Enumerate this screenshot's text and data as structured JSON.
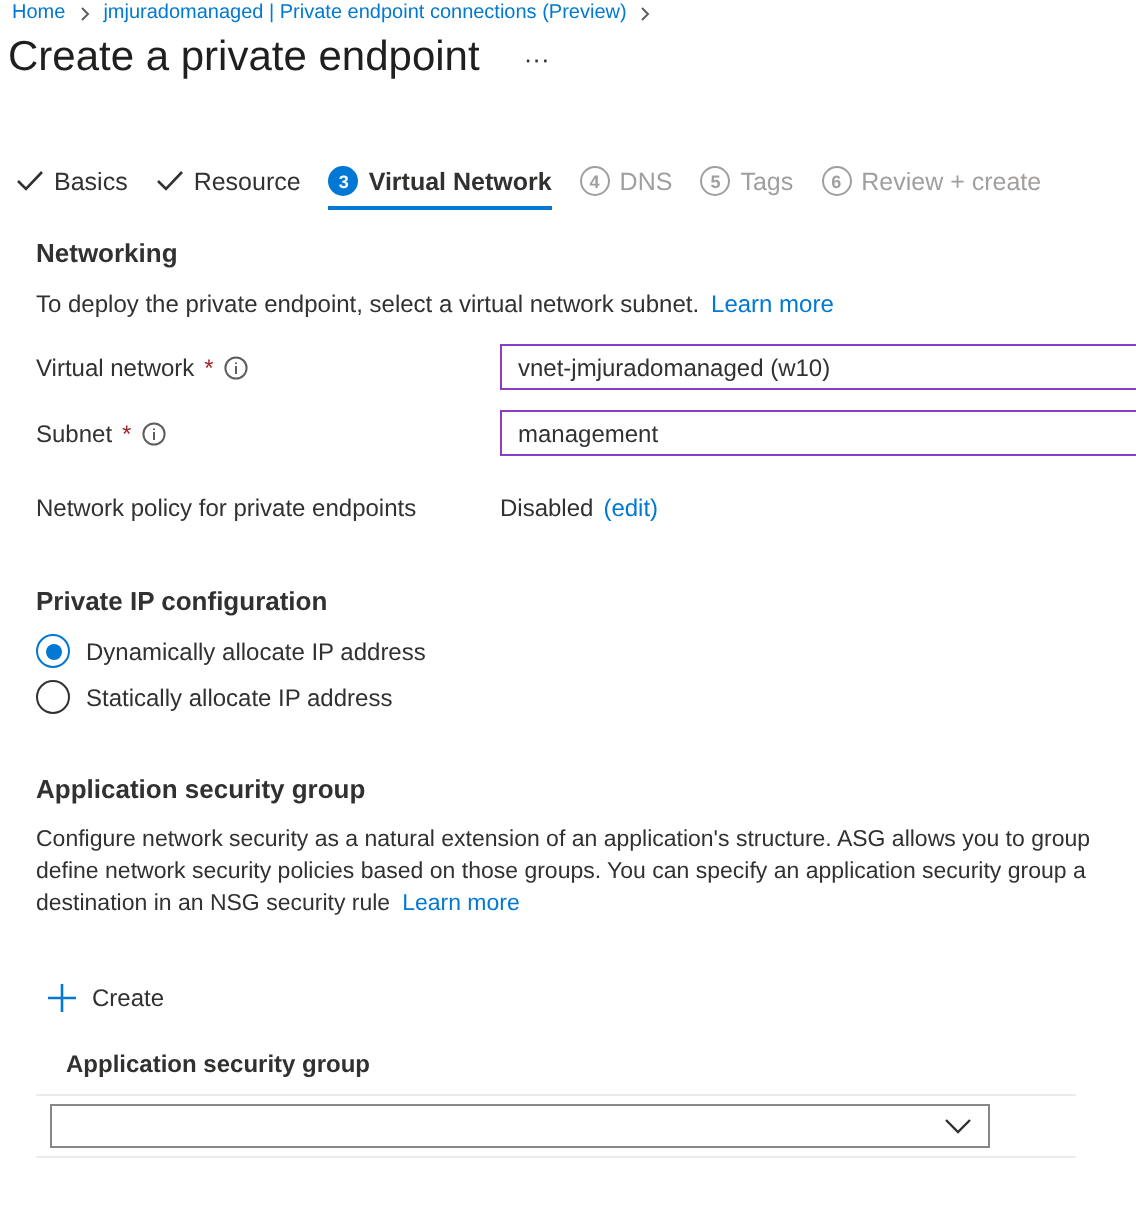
{
  "breadcrumb": [
    {
      "label": "Home"
    },
    {
      "label": "jmjuradomanaged | Private endpoint connections (Preview)"
    }
  ],
  "page_title": "Create a private endpoint",
  "more_menu": "···",
  "steps": [
    {
      "label": "Basics",
      "kind": "done",
      "selected": false
    },
    {
      "label": "Resource",
      "kind": "done",
      "selected": false
    },
    {
      "number": "3",
      "label": "Virtual Network",
      "kind": "current",
      "selected": true
    },
    {
      "number": "4",
      "label": "DNS",
      "kind": "pending",
      "selected": false
    },
    {
      "number": "5",
      "label": "Tags",
      "kind": "pending",
      "selected": false
    },
    {
      "number": "6",
      "label": "Review + create",
      "kind": "pending",
      "selected": false
    }
  ],
  "networking": {
    "heading": "Networking",
    "description": "To deploy the private endpoint, select a virtual network subnet.",
    "link": "Learn more",
    "fields": [
      {
        "label": "Virtual network",
        "required_mark": "*",
        "kind": "select",
        "value": "vnet-jmjuradomanaged (w10)"
      },
      {
        "label": "Subnet",
        "required_mark": "*",
        "kind": "select",
        "value": "management"
      },
      {
        "label": "Network policy for private endpoints",
        "kind": "static",
        "value": "Disabled",
        "link": "(edit)"
      }
    ]
  },
  "ip_config": {
    "heading": "Private IP configuration",
    "options": [
      {
        "label": "Dynamically allocate IP address",
        "selected": true
      },
      {
        "label": "Statically allocate IP address",
        "selected": false
      }
    ]
  },
  "asg": {
    "heading": "Application security group",
    "description": "Configure network security as a natural extension of an application's structure. ASG allows you to group define network security policies based on those groups. You can specify an application security group a destination in an NSG security rule",
    "link": "Learn more",
    "create_button": "Create",
    "column_header": "Application security group"
  }
}
